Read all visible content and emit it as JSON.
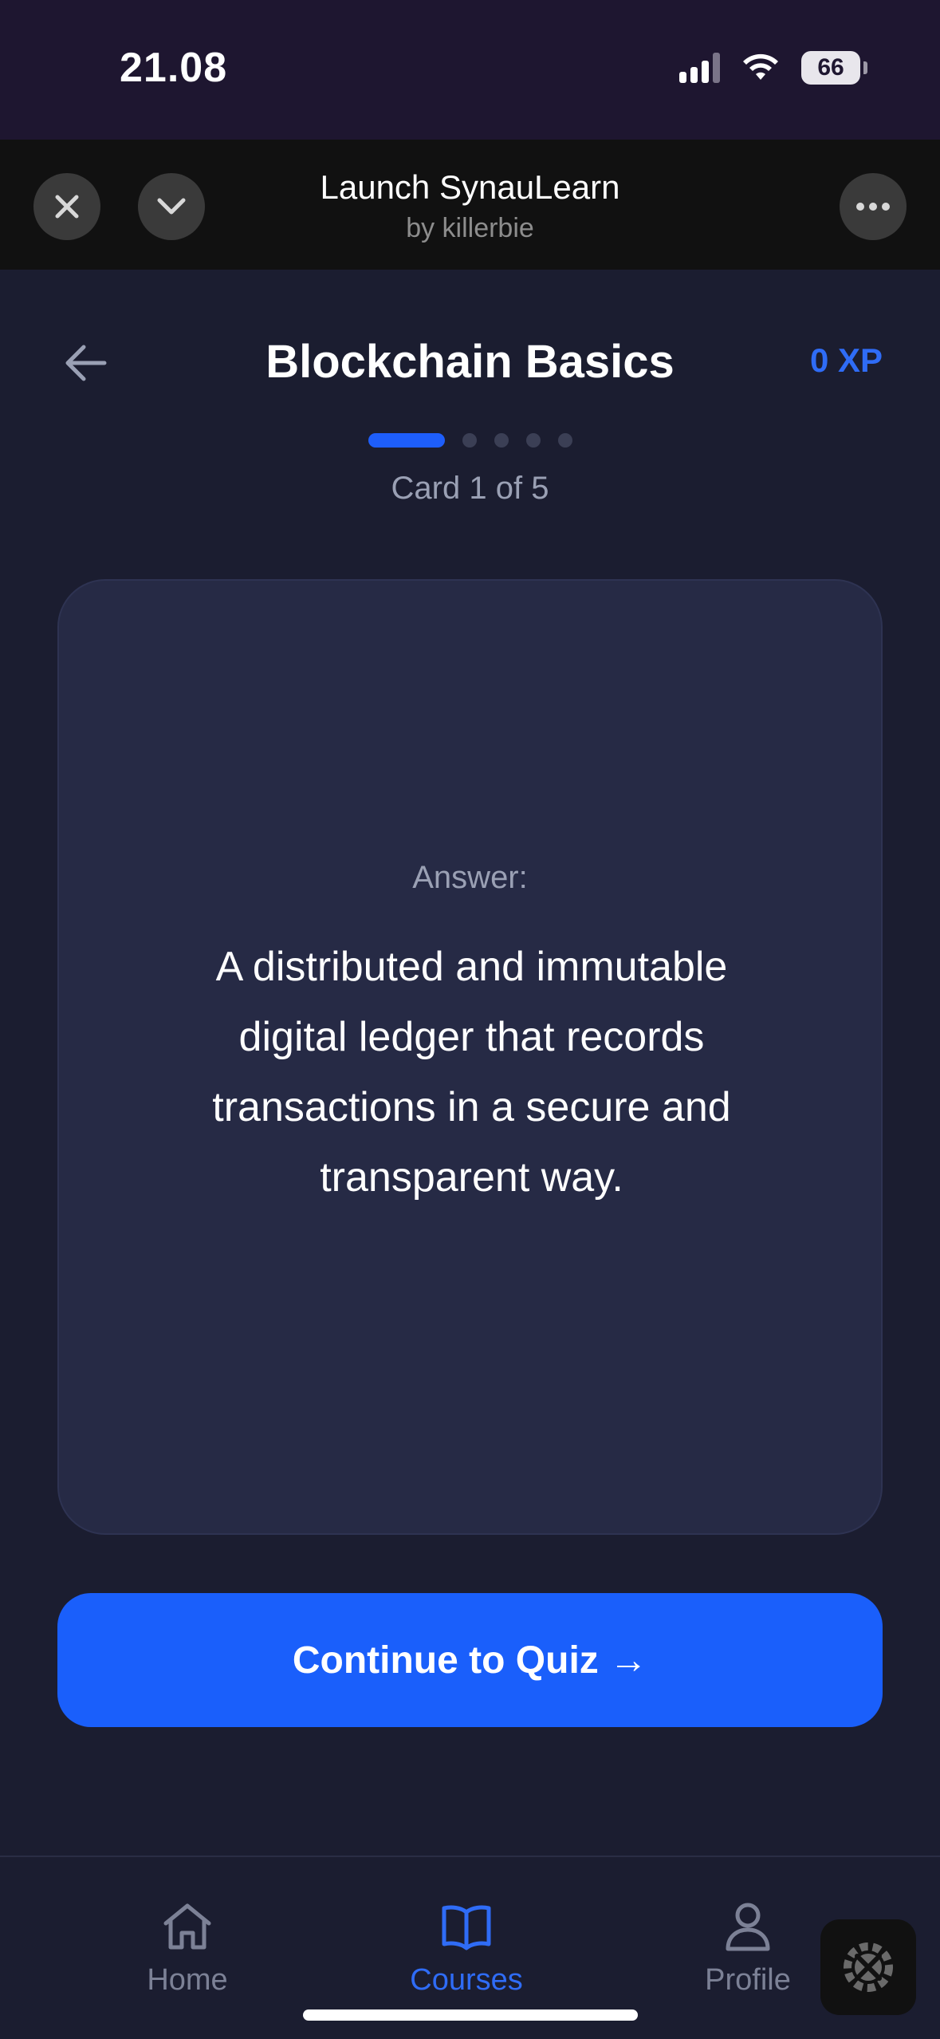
{
  "status_bar": {
    "time": "21.08",
    "battery": "66"
  },
  "mini_app_header": {
    "title": "Launch SynauLearn",
    "subtitle": "by killerbie",
    "icons": [
      "close-icon",
      "chevron-down-icon",
      "more-icon"
    ]
  },
  "course": {
    "title": "Blockchain Basics",
    "xp": "0 XP",
    "card_counter": "Card 1 of 5",
    "current_card": 1,
    "total_cards": 5
  },
  "flashcard": {
    "label": "Answer:",
    "text": "A distributed and immutable digital ledger that records transactions in a secure and transparent way."
  },
  "cta": {
    "label": "Continue to Quiz →"
  },
  "tab_bar": {
    "items": [
      {
        "label": "Home",
        "icon": "home-icon",
        "active": false
      },
      {
        "label": "Courses",
        "icon": "book-icon",
        "active": true
      },
      {
        "label": "Profile",
        "icon": "person-icon",
        "active": false
      }
    ]
  },
  "colors": {
    "accent": "#1a5ffb",
    "background": "#1b1d30",
    "card": "#262a45",
    "xp": "#2f6cf6"
  }
}
